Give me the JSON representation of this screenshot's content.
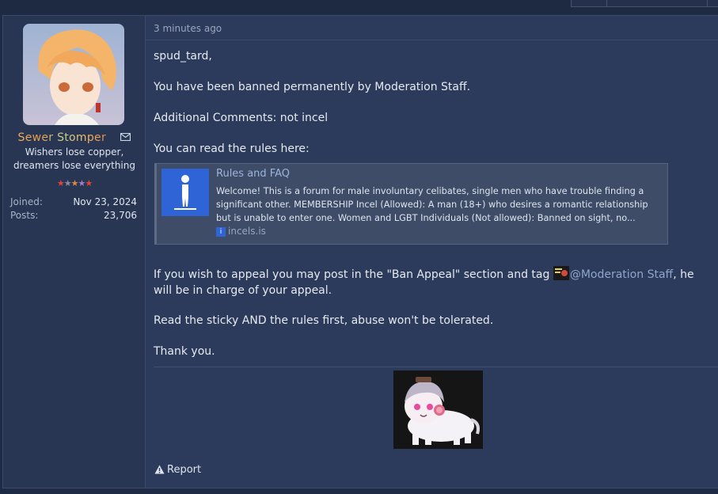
{
  "user": {
    "name": "Sewer Stomper",
    "title": "Wishers lose copper, dreamers lose everything",
    "stars": "★★★★★",
    "stats": [
      {
        "key": "Joined:",
        "value": "Nov 23, 2024"
      },
      {
        "key": "Posts:",
        "value": "23,706"
      }
    ]
  },
  "post": {
    "time": "3 minutes ago",
    "greeting": "spud_tard,",
    "line1": "You have been banned permanently by Moderation Staff.",
    "line2": "Additional Comments: not incel",
    "line3": "You can read the rules here:",
    "embed": {
      "title": "Rules and FAQ",
      "description": "Welcome! This is a forum for male involuntary celibates, single men who have trouble finding a significant other. MEMBERSHIP Incel (Allowed): A man (18+) who desires a romantic relationship but is unable to enter one. Women and LGBT Individuals (Not allowed): Banned on sight, no...",
      "domain": "incels.is"
    },
    "appeal_before": "If you wish to appeal you may post in the \"Ban Appeal\" section and tag ",
    "mention": "@Moderation Staff",
    "appeal_after": ", he will be in charge of your appeal.",
    "line4": "Read the sticky AND the rules first, abuse won't be tolerated.",
    "line5": "Thank you.",
    "report_label": "Report"
  },
  "colors": {
    "background": "#1f2b44",
    "post_bg": "#2c3b5b",
    "sidebar_bg": "#283654",
    "link": "#8ea6cc",
    "star_active": "#e0453c"
  }
}
